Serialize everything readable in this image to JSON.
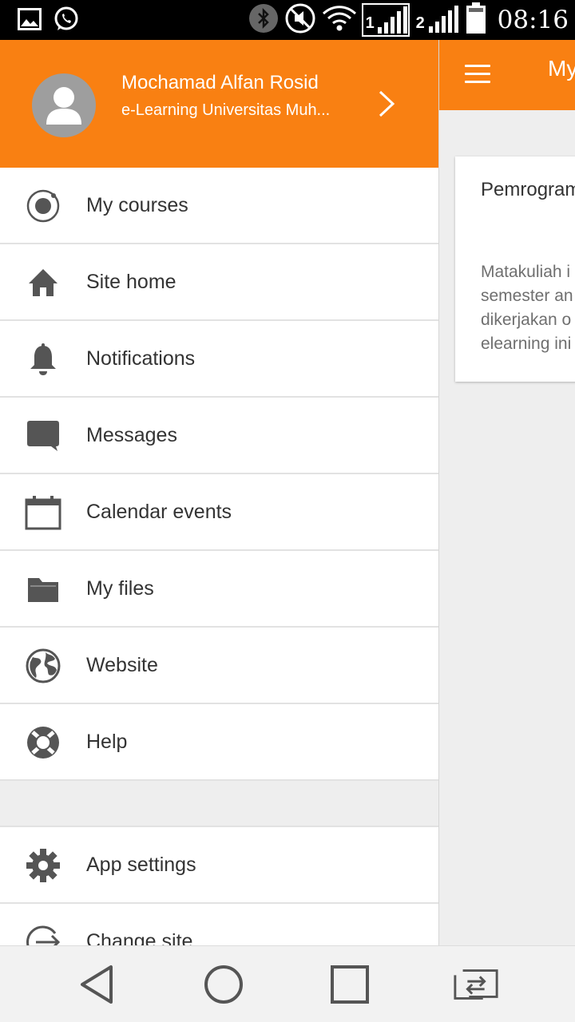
{
  "status_bar": {
    "time": "08:16",
    "sim1_label": "1",
    "sim2_label": "2"
  },
  "background_app": {
    "title": "My",
    "course": {
      "title": "Pemrogram",
      "description_lines": [
        "Matakuliah i",
        "semester an",
        "dikerjakan o",
        "elearning ini"
      ]
    }
  },
  "drawer": {
    "user_name": "Mochamad Alfan Rosid",
    "site_name": "e-Learning Universitas Muh...",
    "items": [
      {
        "label": "My courses",
        "icon": "my-courses-icon"
      },
      {
        "label": "Site home",
        "icon": "home-icon"
      },
      {
        "label": "Notifications",
        "icon": "bell-icon"
      },
      {
        "label": "Messages",
        "icon": "chat-icon"
      },
      {
        "label": "Calendar events",
        "icon": "calendar-icon"
      },
      {
        "label": "My files",
        "icon": "folder-icon"
      },
      {
        "label": "Website",
        "icon": "globe-icon"
      },
      {
        "label": "Help",
        "icon": "lifebuoy-icon"
      }
    ],
    "bottom_items": [
      {
        "label": "App settings",
        "icon": "gear-icon"
      },
      {
        "label": "Change site",
        "icon": "logout-icon"
      }
    ]
  },
  "colors": {
    "brand": "#f98012",
    "icon": "#555555",
    "text": "#333333"
  }
}
